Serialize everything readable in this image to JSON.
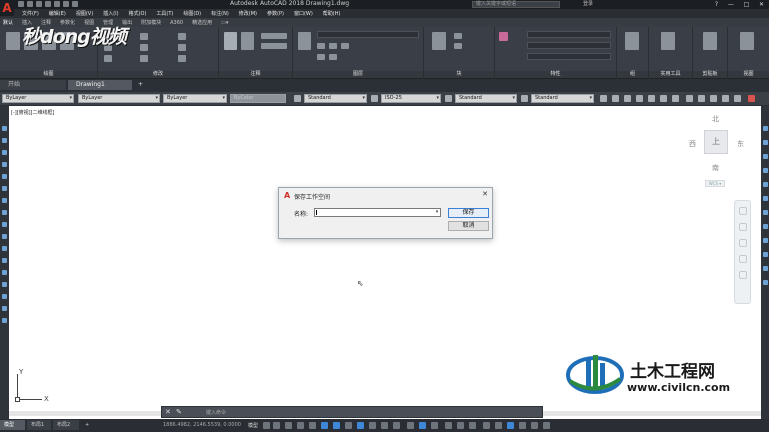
{
  "app": {
    "title": "Autodesk AutoCAD 2018    Drawing1.dwg",
    "search_placeholder": "键入关键字或短语",
    "signin": "登录",
    "window_controls": [
      "?",
      "—",
      "□",
      "✕"
    ]
  },
  "menu": [
    "文件(F)",
    "编辑(E)",
    "视图(V)",
    "插入(I)",
    "格式(O)",
    "工具(T)",
    "绘图(D)",
    "标注(N)",
    "修改(M)",
    "参数(P)",
    "窗口(W)",
    "帮助(H)"
  ],
  "ribbon_tabs": [
    "默认",
    "插入",
    "注释",
    "参数化",
    "视图",
    "管理",
    "输出",
    "附加模块",
    "A360",
    "精选应用",
    "▭▾"
  ],
  "ribbon_panels": [
    "绘图",
    "修改",
    "注释",
    "图层",
    "块",
    "特性",
    "组",
    "实用工具",
    "剪贴板",
    "视图"
  ],
  "watermark_top": "秒dong视频",
  "file_tabs": {
    "start": "开始",
    "drawing": "Drawing1",
    "add": "+"
  },
  "props": {
    "layer": "ByLayer",
    "linetype1": "ByLayer",
    "linetype2": "ByLayer",
    "color": "ByColor",
    "text_style": "Standard",
    "dim_style": "ISO-25",
    "table_style": "Standard",
    "mleader_style": "Standard"
  },
  "viewport_label": "[-][俯视][二维线框]",
  "viewcube": {
    "north": "北",
    "west": "西",
    "east": "东",
    "south": "南",
    "face": "上",
    "wcs": "WCS ▾"
  },
  "dialog": {
    "title": "保存工作空间",
    "name_label": "名称:",
    "name_value": "",
    "save_button": "保存",
    "cancel_button": "取消",
    "close": "✕"
  },
  "ucs": {
    "x": "X",
    "y": "Y"
  },
  "command": {
    "placeholder": "键入命令"
  },
  "watermark_bottom": {
    "title": "土木工程网",
    "url": "www.civilcn.com"
  },
  "status": {
    "model_tab": "模型",
    "layout1": "布局1",
    "layout2": "布局2",
    "add": "+",
    "coords": "1886.4982, 2146.5539, 0.0000",
    "model_label": "模型"
  }
}
